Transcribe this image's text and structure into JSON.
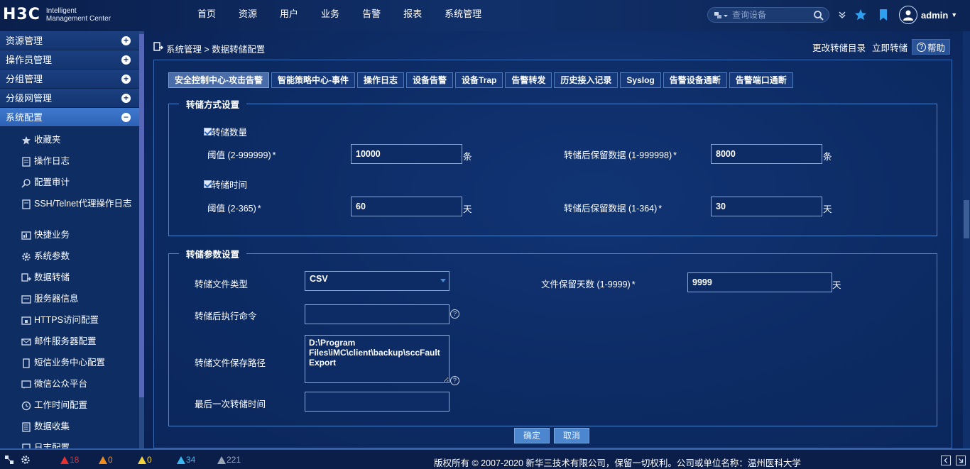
{
  "header": {
    "logo_text": "H3C",
    "logo_sub_line1": "Intelligent",
    "logo_sub_line2": "Management Center",
    "nav": [
      "首页",
      "资源",
      "用户",
      "业务",
      "告警",
      "报表",
      "系统管理"
    ],
    "search_placeholder": "查询设备",
    "user_name": "admin"
  },
  "sidebar": {
    "groups": [
      {
        "label": "资源管理",
        "toggle": "+"
      },
      {
        "label": "操作员管理",
        "toggle": "+"
      },
      {
        "label": "分组管理",
        "toggle": "+"
      },
      {
        "label": "分级网管理",
        "toggle": "+"
      },
      {
        "label": "系统配置",
        "toggle": "−",
        "active": true
      }
    ],
    "items": [
      {
        "label": "收藏夹",
        "icon": "star-icon"
      },
      {
        "label": "操作日志",
        "icon": "log-icon"
      },
      {
        "label": "配置审计",
        "icon": "audit-icon"
      },
      {
        "label": "SSH/Telnet代理操作日志",
        "icon": "terminal-icon"
      },
      {
        "label": "快捷业务",
        "icon": "shortcut-icon"
      },
      {
        "label": "系统参数",
        "icon": "gear-icon"
      },
      {
        "label": "数据转储",
        "icon": "data-dump-icon"
      },
      {
        "label": "服务器信息",
        "icon": "server-icon"
      },
      {
        "label": "HTTPS访问配置",
        "icon": "https-icon"
      },
      {
        "label": "邮件服务器配置",
        "icon": "mail-server-icon"
      },
      {
        "label": "短信业务中心配置",
        "icon": "sms-icon"
      },
      {
        "label": "微信公众平台",
        "icon": "wechat-icon"
      },
      {
        "label": "工作时间配置",
        "icon": "clock-icon"
      },
      {
        "label": "数据收集",
        "icon": "collect-icon"
      },
      {
        "label": "日志配置",
        "icon": "log-config-icon"
      }
    ]
  },
  "breadcrumb": {
    "path": "系统管理 > 数据转储配置",
    "action_change_dir": "更改转储目录",
    "action_dump_now": "立即转储",
    "help": "帮助"
  },
  "tabs": [
    {
      "label": "安全控制中心-攻击告警",
      "active": true
    },
    {
      "label": "智能策略中心-事件"
    },
    {
      "label": "操作日志"
    },
    {
      "label": "设备告警"
    },
    {
      "label": "设备Trap"
    },
    {
      "label": "告警转发"
    },
    {
      "label": "历史接入记录"
    },
    {
      "label": "Syslog"
    },
    {
      "label": "告警设备通断"
    },
    {
      "label": "告警端口通断"
    }
  ],
  "dump_mode": {
    "legend": "转储方式设置",
    "by_count": {
      "checkbox_label": "转储数量",
      "checked": true,
      "threshold_label": "阈值 (2-999999)",
      "threshold_value": "10000",
      "threshold_unit": "条",
      "retain_label": "转储后保留数据 (1-999998)",
      "retain_value": "8000",
      "retain_unit": "条"
    },
    "by_time": {
      "checkbox_label": "转储时间",
      "checked": true,
      "threshold_label": "阈值 (2-365)",
      "threshold_value": "60",
      "threshold_unit": "天",
      "retain_label": "转储后保留数据 (1-364)",
      "retain_value": "30",
      "retain_unit": "天"
    }
  },
  "dump_params": {
    "legend": "转储参数设置",
    "file_type_label": "转储文件类型",
    "file_type_value": "CSV",
    "retain_days_label": "文件保留天数 (1-9999)",
    "retain_days_value": "9999",
    "retain_days_unit": "天",
    "post_cmd_label": "转储后执行命令",
    "post_cmd_value": "",
    "path_label": "转储文件保存路径",
    "path_value": "D:\\Program Files\\iMC\\client\\backup\\sccFaultExport",
    "last_time_label": "最后一次转储时间",
    "last_time_value": "",
    "required_mark": "*"
  },
  "buttons": {
    "ok": "确定",
    "cancel": "取消"
  },
  "statusbar": {
    "alarm_critical": "18",
    "alarm_major": "0",
    "alarm_minor": "0",
    "alarm_warning": "34",
    "alarm_info": "221",
    "copyright": "版权所有 © 2007-2020 新华三技术有限公司，保留一切权利。公司或单位名称：温州医科大学"
  },
  "colors": {
    "critical": "#e5322d",
    "major": "#f08c1e",
    "minor": "#f3d23a",
    "warning": "#39b8f0",
    "info": "#9aa6b8",
    "accent": "#2d62b5"
  }
}
